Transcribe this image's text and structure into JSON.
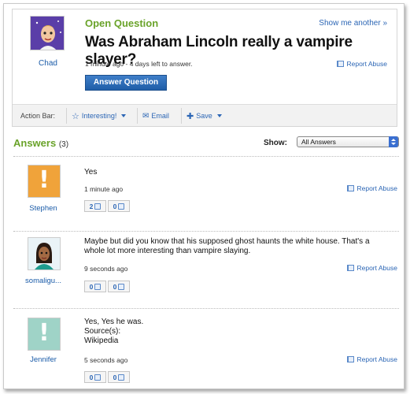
{
  "question": {
    "kicker": "Open Question",
    "show_another": "Show me another »",
    "title": "Was Abraham Lincoln really a vampire slayer?",
    "meta": "1 minute ago - 4 days left to answer.",
    "report": "Report Abuse",
    "answer_button": "Answer Question",
    "asker": "Chad"
  },
  "action_bar": {
    "label": "Action Bar:",
    "interesting": "Interesting!",
    "email": "Email",
    "save": "Save"
  },
  "answers_header": {
    "title": "Answers",
    "count": "(3)",
    "show_label": "Show:",
    "show_value": "All Answers"
  },
  "answers": [
    {
      "user": "Stephen",
      "text": "Yes",
      "time": "1 minute ago",
      "up": "2",
      "down": "0",
      "report": "Report Abuse",
      "avatar_color": "#f0a33a"
    },
    {
      "user": "somaligu...",
      "text": "Maybe but did you know that his supposed ghost haunts the white house. That's a whole lot more interesting than vampire slaying.",
      "time": "9 seconds ago",
      "up": "0",
      "down": "0",
      "report": "Report Abuse",
      "avatar_color": "#f3ecd8"
    },
    {
      "user": "Jennifer",
      "text_lines": [
        "Yes, Yes he was.",
        "Source(s):",
        "Wikipedia"
      ],
      "time": "5 seconds ago",
      "up": "0",
      "down": "0",
      "report": "Report Abuse",
      "avatar_color": "#9fd3c7"
    }
  ],
  "colors": {
    "accent_green": "#6aa32a",
    "link_blue": "#2c66b5",
    "button_blue": "#1f5ea8"
  }
}
